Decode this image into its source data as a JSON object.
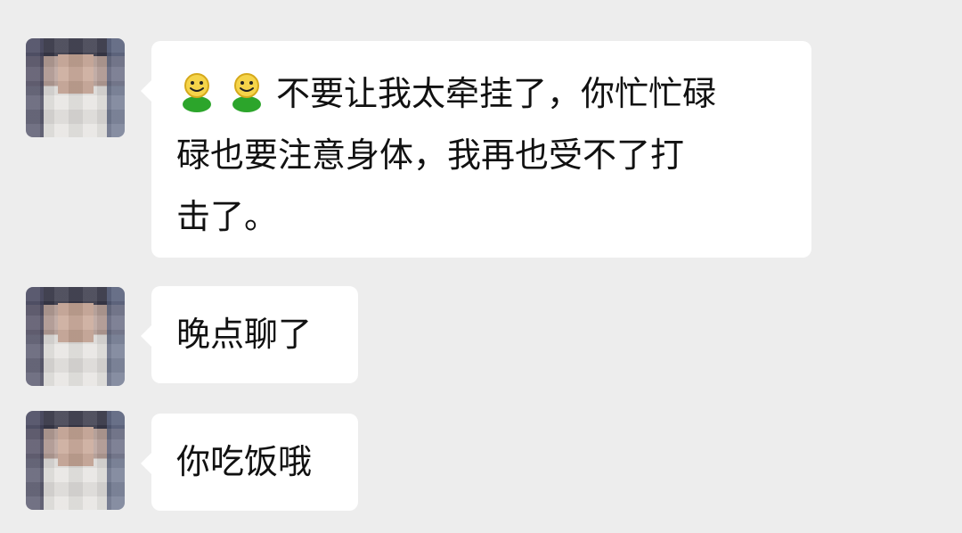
{
  "messages": [
    {
      "avatar": "blurred-contact-avatar",
      "emoji": [
        "smiling-person-icon",
        "smiling-person-icon"
      ],
      "lines": [
        "不要让我太牵挂了，你忙忙碌",
        "碌也要注意身体，我再也受不了打",
        "击了。"
      ]
    },
    {
      "avatar": "blurred-contact-avatar",
      "text": "晚点聊了"
    },
    {
      "avatar": "blurred-contact-avatar",
      "text": "你吃饭哦"
    }
  ]
}
